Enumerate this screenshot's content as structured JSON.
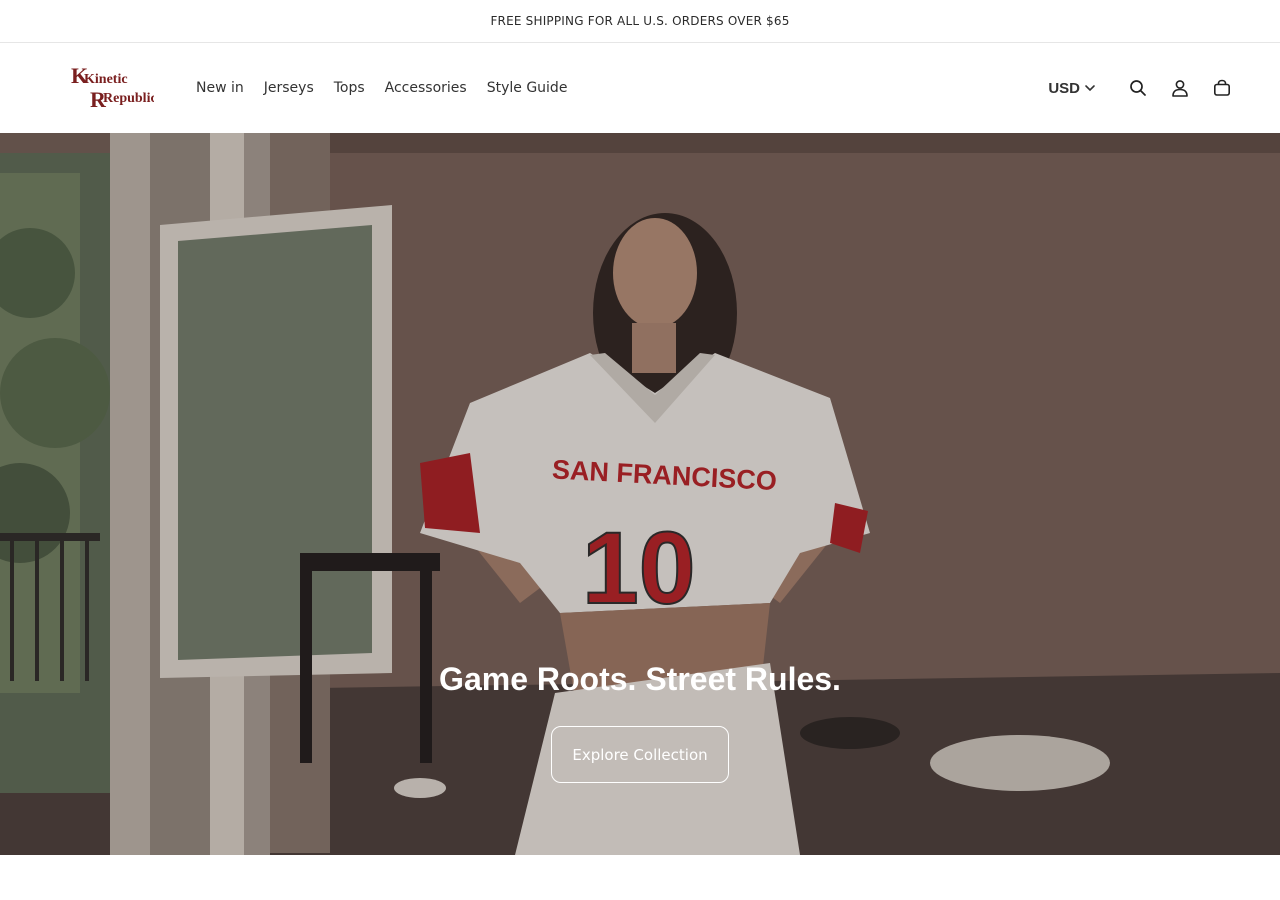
{
  "announcement": {
    "text": "FREE SHIPPING FOR ALL U.S. ORDERS OVER $65"
  },
  "brand": {
    "line1": "Kinetic",
    "line2": "Republic",
    "color": "#7a1f1f"
  },
  "nav": {
    "items": [
      {
        "label": "New in"
      },
      {
        "label": "Jerseys"
      },
      {
        "label": "Tops"
      },
      {
        "label": "Accessories"
      },
      {
        "label": "Style Guide"
      }
    ]
  },
  "tools": {
    "currency": "USD",
    "icons": [
      "search-icon",
      "account-icon",
      "cart-icon"
    ]
  },
  "hero": {
    "title": "Game Roots. Street Rules.",
    "button_label": "Explore Collection",
    "image": {
      "jersey_text": "SAN FRANCISCO",
      "jersey_number": "10"
    }
  }
}
